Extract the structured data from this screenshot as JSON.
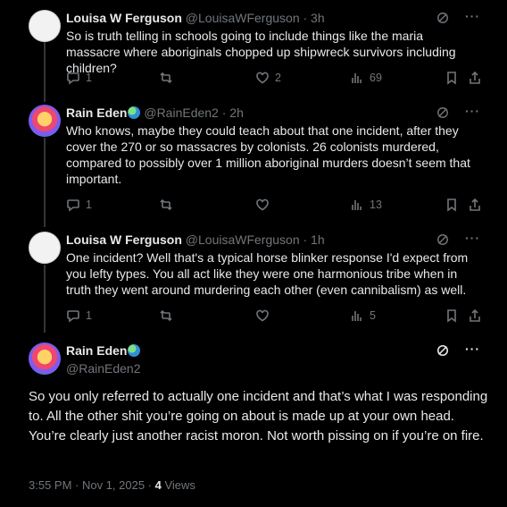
{
  "tweets": [
    {
      "name": "Louisa W Ferguson",
      "handle": "@LouisaWFerguson",
      "time": "· 3h",
      "text": "So is truth telling in schools going to include things like the maria massacre where aboriginals chopped up shipwreck survivors including children?",
      "replies": "1",
      "retweets": "",
      "likes": "2",
      "views": "69"
    },
    {
      "name": "Rain Eden",
      "handle": "@RainEden2",
      "time": "· 2h",
      "text": "Who knows, maybe they could teach about that one incident, after they cover the 270 or so massacres by colonists. 26 colonists murdered, compared to possibly over 1 million aboriginal murders doesn’t seem that important.",
      "replies": "1",
      "retweets": "",
      "likes": "",
      "views": "13"
    },
    {
      "name": "Louisa W Ferguson",
      "handle": "@LouisaWFerguson",
      "time": "· 1h",
      "text": "One incident? Well that's a typical horse blinker response I'd expect from you lefty types.  You all act like they were one harmonious tribe when in truth they went around murdering each other (even cannibalism) as well.",
      "replies": "1",
      "retweets": "",
      "likes": "",
      "views": "5"
    }
  ],
  "focal": {
    "name": "Rain Eden",
    "handle": "@RainEden2",
    "text": "So you only referred to actually one incident and that’s what I was responding to. All the other shit you’re going on about is made up at your own head. You’re clearly just another racist moron. Not worth pissing on if you’re on fire.",
    "timestamp": "3:55 PM · Nov 1, 2025 · ",
    "views_count": "4",
    "views_label": " Views"
  },
  "icons": [
    "grok-icon",
    "more-icon",
    "reply-icon",
    "retweet-icon",
    "like-icon",
    "views-icon",
    "bookmark-icon",
    "share-icon"
  ],
  "colors": {
    "background": "#000000",
    "text": "#e7e9ea",
    "secondary": "#71767b",
    "thread_line": "#333639"
  }
}
